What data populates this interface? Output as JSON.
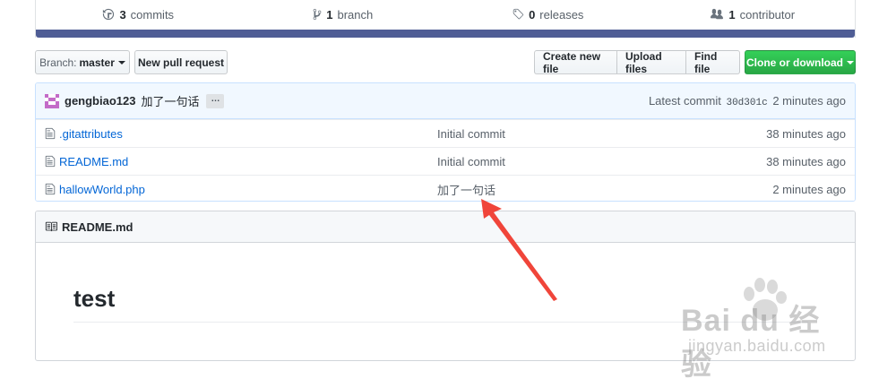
{
  "summary": {
    "commits": {
      "count": "3",
      "label": "commits"
    },
    "branches": {
      "count": "1",
      "label": "branch"
    },
    "releases": {
      "count": "0",
      "label": "releases"
    },
    "contributors": {
      "count": "1",
      "label": "contributor"
    }
  },
  "toolbar": {
    "branch_prefix": "Branch:",
    "branch_name": "master",
    "new_pr": "New pull request",
    "create_file": "Create new file",
    "upload_files": "Upload files",
    "find_file": "Find file",
    "clone": "Clone or download"
  },
  "latest_commit": {
    "author": "gengbiao123",
    "message": "加了一句话",
    "ellipsis": "…",
    "prefix": "Latest commit",
    "sha": "30d301c",
    "age": "2 minutes ago"
  },
  "files": [
    {
      "name": ".gitattributes",
      "message": "Initial commit",
      "age": "38 minutes ago"
    },
    {
      "name": "README.md",
      "message": "Initial commit",
      "age": "38 minutes ago"
    },
    {
      "name": "hallowWorld.php",
      "message": "加了一句话",
      "age": "2 minutes ago"
    }
  ],
  "readme": {
    "filename": "README.md",
    "heading": "test"
  },
  "watermark": {
    "logo": "Bai du 经验",
    "url": "jingyan.baidu.com"
  },
  "colors": {
    "language_bar": "#4f5d95",
    "clone_button": "#28a745",
    "link": "#0366d6",
    "annotation_arrow": "#f0453a"
  },
  "icons": {
    "commits": "history-icon",
    "branch": "git-branch-icon",
    "releases": "tag-icon",
    "contributors": "people-icon",
    "file": "file-text-icon",
    "readme": "book-icon"
  }
}
